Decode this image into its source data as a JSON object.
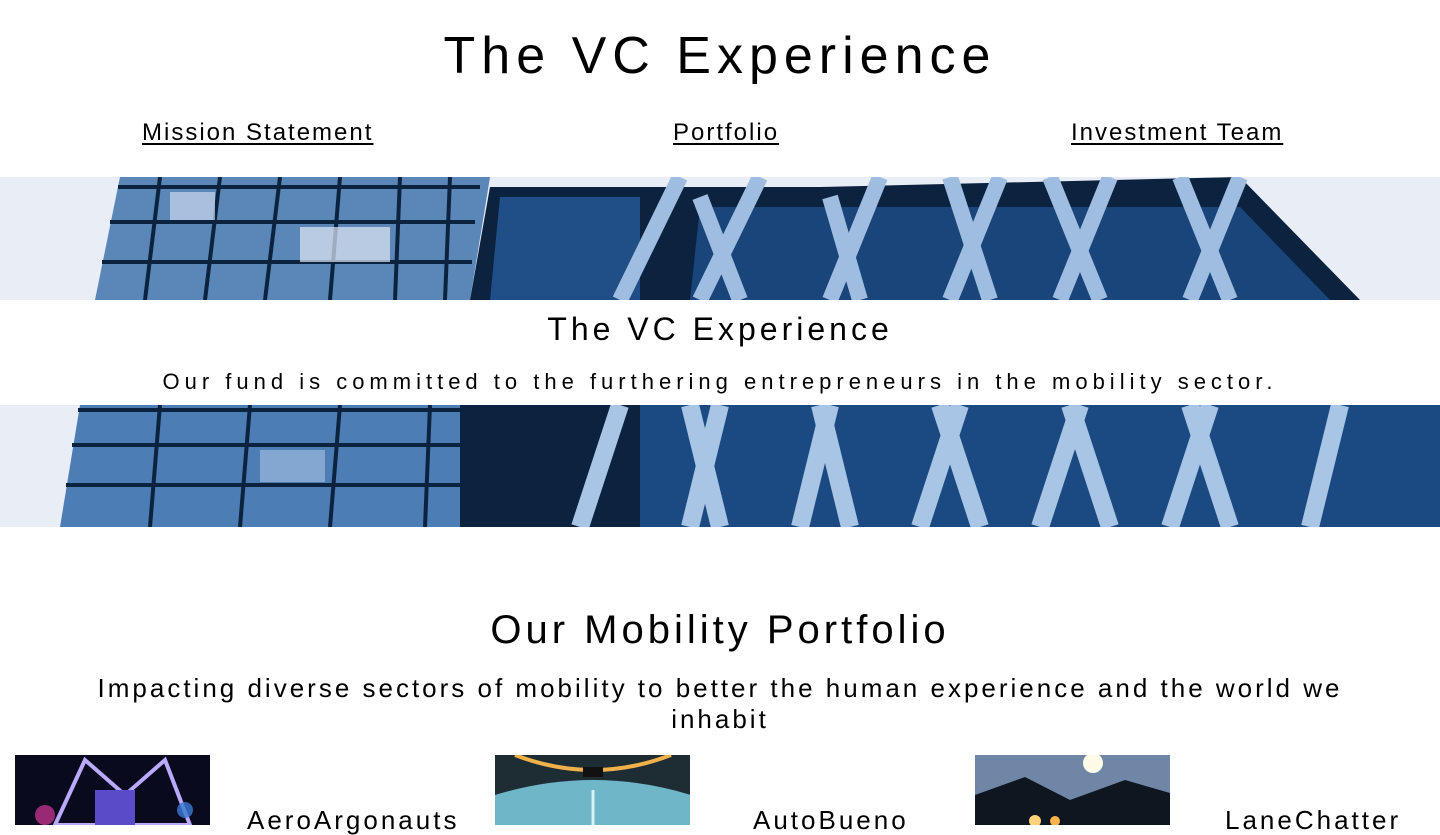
{
  "header": {
    "site_title": "The VC Experience",
    "nav": [
      {
        "label": "Mission Statement"
      },
      {
        "label": "Portfolio"
      },
      {
        "label": "Investment Team"
      }
    ]
  },
  "hero": {
    "title": "The VC Experience",
    "subtitle": "Our fund is committed to the furthering entrepreneurs in the mobility sector."
  },
  "portfolio": {
    "title": "Our Mobility Portfolio",
    "subtitle": "Impacting diverse sectors of mobility to better the human experience and the world we inhabit",
    "companies": [
      {
        "name": "AeroArgonauts"
      },
      {
        "name": "AutoBueno"
      },
      {
        "name": "LaneChatter"
      }
    ]
  },
  "colors": {
    "building_blue": "#2f5f96",
    "building_dark": "#0c2340",
    "sky": "#e9eef6"
  }
}
